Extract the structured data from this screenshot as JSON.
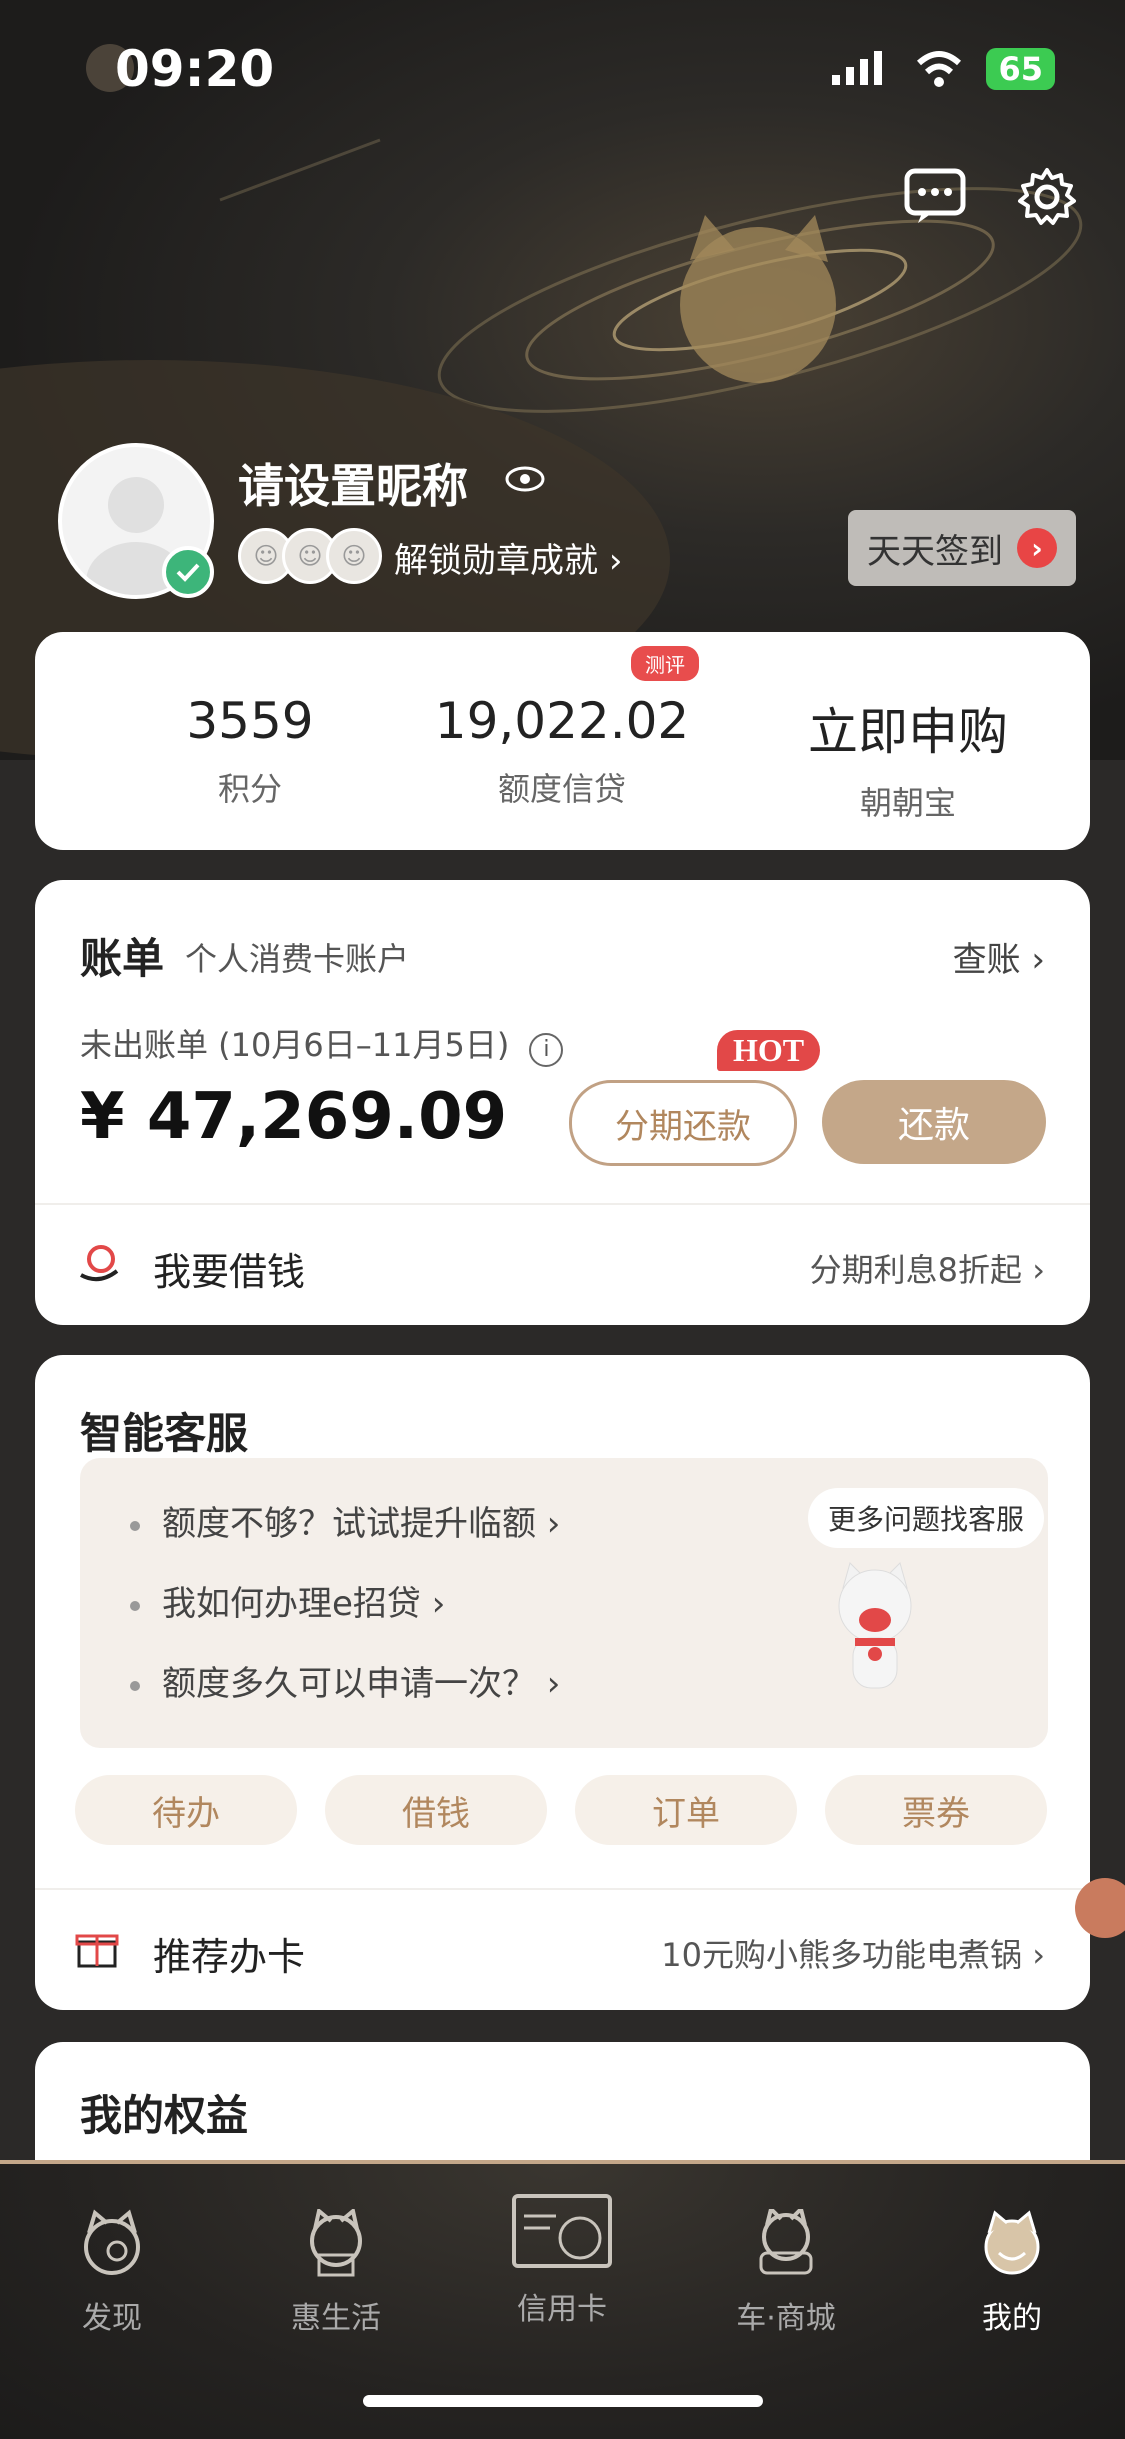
{
  "status": {
    "time": "09:20",
    "battery": "65"
  },
  "profile": {
    "nickname": "请设置昵称",
    "unlock_label": "解锁勋章成就",
    "signin_label": "天天签到"
  },
  "stats": {
    "test_tag": "测评",
    "items": [
      {
        "value": "3559",
        "label": "积分"
      },
      {
        "value": "19,022.02",
        "label": "额度信贷"
      },
      {
        "value": "立即申购",
        "label": "朝朝宝"
      }
    ]
  },
  "bill": {
    "title": "账单",
    "subtitle": "个人消费卡账户",
    "check_label": "查账",
    "period": "未出账单 (10月6日–11月5日)",
    "amount": "¥ 47,269.09",
    "hot_tag": "HOT",
    "installment_label": "分期还款",
    "repay_label": "还款",
    "borrow_label": "我要借钱",
    "borrow_promo": "分期利息8折起"
  },
  "service": {
    "title": "智能客服",
    "faqs": [
      "额度不够？试试提升临额",
      "我如何办理e招贷",
      "额度多久可以申请一次？"
    ],
    "bubble": "更多问题找客服",
    "chips": [
      "待办",
      "借钱",
      "订单",
      "票券"
    ],
    "recommend_label": "推荐办卡",
    "recommend_promo": "10元购小熊多功能电煮锅"
  },
  "benefit": {
    "title": "我的权益"
  },
  "tabs": [
    {
      "label": "发现",
      "active": false
    },
    {
      "label": "惠生活",
      "active": false
    },
    {
      "label": "信用卡",
      "active": false
    },
    {
      "label": "车·商城",
      "active": false
    },
    {
      "label": "我的",
      "active": true
    }
  ],
  "colors": {
    "accent": "#c4a789",
    "hot": "#e24848",
    "dark_bg": "#2b2928"
  }
}
